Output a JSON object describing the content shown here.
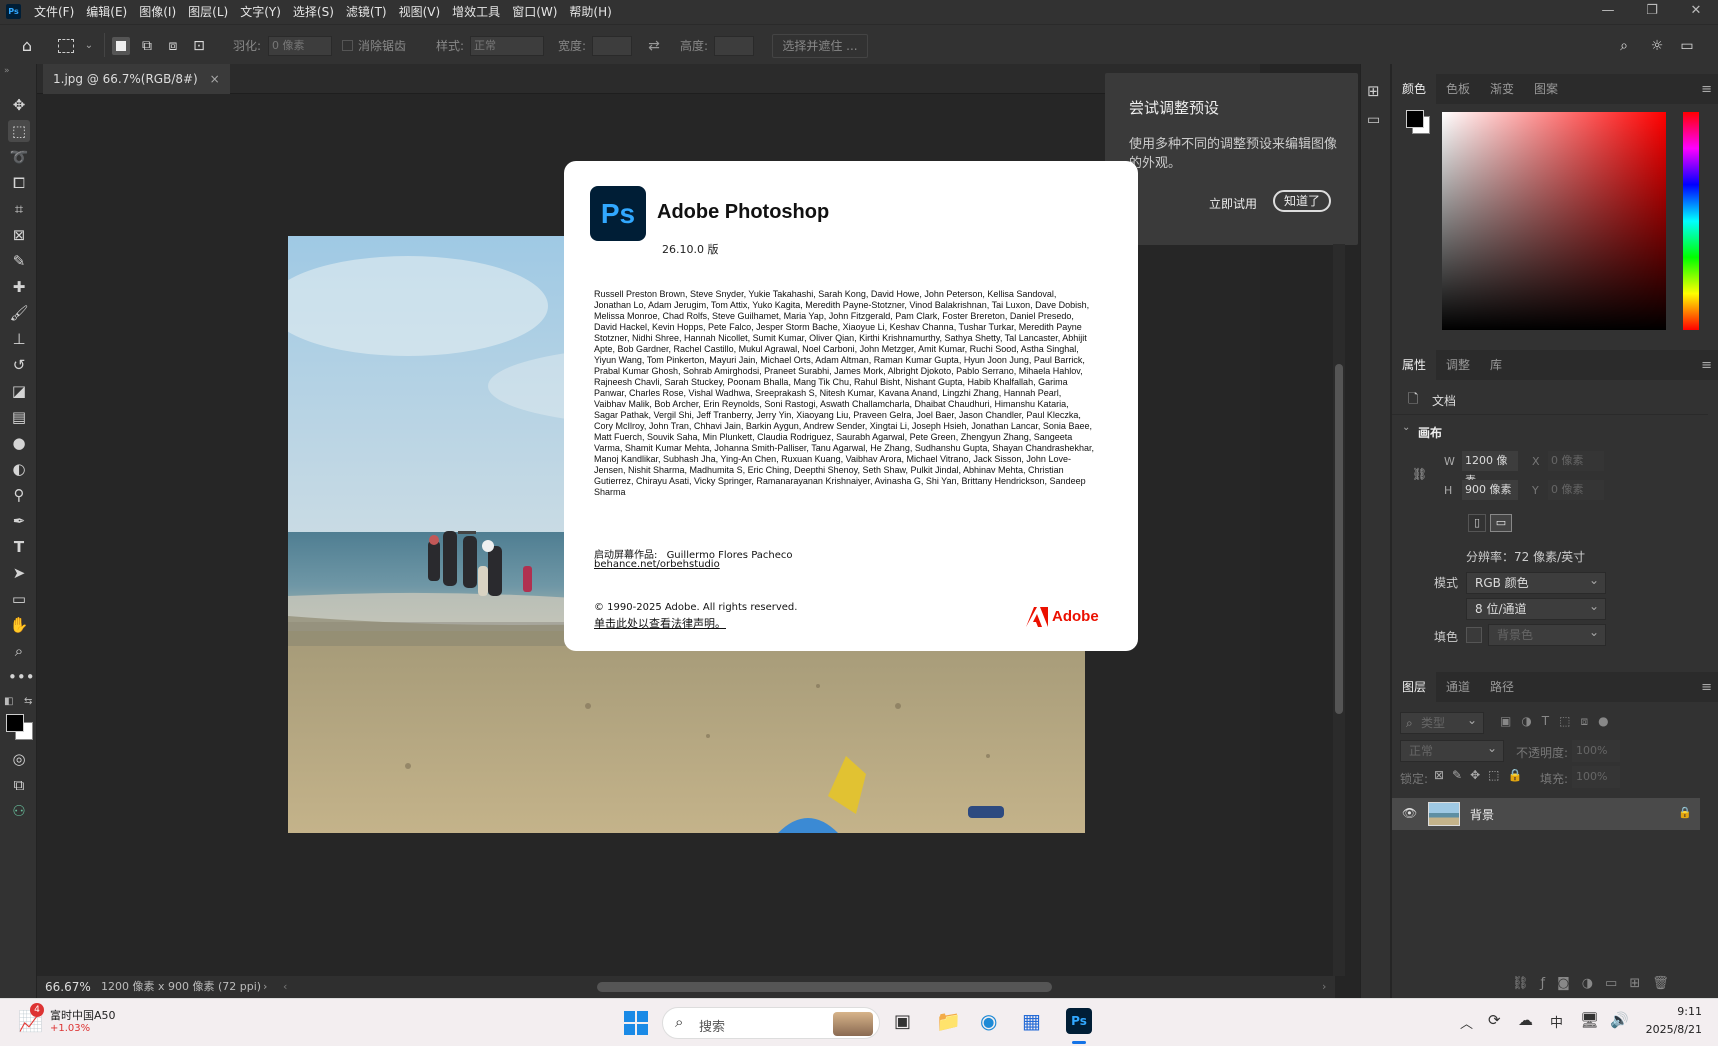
{
  "menubar": {
    "logo": "Ps",
    "items": [
      "文件(F)",
      "编辑(E)",
      "图像(I)",
      "图层(L)",
      "文字(Y)",
      "选择(S)",
      "滤镜(T)",
      "视图(V)",
      "增效工具",
      "窗口(W)",
      "帮助(H)"
    ]
  },
  "options": {
    "feather_label": "羽化:",
    "feather_value": "0 像素",
    "antialias_label": "消除锯齿",
    "style_label": "样式:",
    "style_value": "正常",
    "width_label": "宽度:",
    "height_label": "高度:",
    "select_mask": "选择并遮住 ..."
  },
  "document": {
    "tab_label": "1.jpg @ 66.7%(RGB/8#)",
    "zoom": "66.67%",
    "info": "1200 像素 x 900 像素 (72 ppi)"
  },
  "tip": {
    "title": "尝试调整预设",
    "body": "使用多种不同的调整预设来编辑图像的外观。",
    "try_label": "立即试用",
    "ok_label": "知道了"
  },
  "about": {
    "logo_text": "Ps",
    "app_name": "Adobe Photoshop",
    "version": "26.10.0 版",
    "credits": "Russell Preston Brown, Steve Snyder, Yukie Takahashi, Sarah Kong, David Howe, John Peterson, Kellisa Sandoval, Jonathan Lo, Adam Jerugim, Tom Attix, Yuko Kagita, Meredith Payne-Stotzner, Vinod Balakrishnan, Tai Luxon, Dave Dobish, Melissa Monroe, Chad Rolfs, Steve Guilhamet, Maria Yap, John Fitzgerald, Pam Clark, Foster Brereton, Daniel Presedo, David Hackel, Kevin Hopps, Pete Falco, Jesper Storm Bache, Xiaoyue Li, Keshav Channa, Tushar Turkar, Meredith Payne Stotzner, Nidhi Shree, Hannah Nicollet, Sumit Kumar, Oliver Qian, Kirthi Krishnamurthy, Sathya Shetty, Tal Lancaster, Abhijit Apte, Bob Gardner, Rachel Castillo, Mukul Agrawal, Noel Carboni, John Metzger, Amit Kumar, Ruchi Sood, Astha Singhal, Yiyun Wang, Tom Pinkerton, Mayuri Jain, Michael Orts, Adam Altman, Raman Kumar Gupta, Hyun Joon Jung, Paul Barrick, Prabal Kumar Ghosh, Sohrab Amirghodsi, Praneet Surabhi, James Mork, Albright Djokoto, Pablo Serrano, Mihaela Hahlov, Rajneesh Chavli, Sarah Stuckey, Poonam Bhalla, Mang Tik Chu, Rahul Bisht, Nishant Gupta, Habib Khalfallah, Garima Panwar, Charles Rose, Vishal Wadhwa, Sreeprakash S, Nitesh Kumar, Kavana Anand, Lingzhi Zhang, Hannah Pearl, Vaibhav Malik, Bob Archer, Erin Reynolds, Soni Rastogi, Aswath Challamcharla, Dhaibat Chaudhuri, Himanshu Kataria, Sagar Pathak, Vergil Shi, Jeff Tranberry, Jerry Yin, Xiaoyang Liu, Praveen Gelra, Joel Baer, Jason Chandler, Paul Kleczka, Cory McIlroy, John Tran, Chhavi Jain, Barkin Aygun, Andrew Sender, Xingtai Li, Joseph Hsieh, Jonathan Lancar, Sonia Baee, Matt Fuerch, Souvik Saha, Min Plunkett, Claudia Rodriguez, Saurabh Agarwal, Pete Green, Zhengyun Zhang, Sangeeta Varma, Shamit Kumar Mehta, Johanna Smith-Palliser, Tanu Agarwal, He Zhang, Sudhanshu Gupta, Shayan Chandrashekhar, Manoj Kandlikar, Subhash Jha, Ying-An Chen, Ruxuan Kuang, Vaibhav Arora, Michael Vitrano, Jack Sisson, John Love-Jensen, Nishit Sharma, Madhumita S, Eric Ching, Deepthi Shenoy, Seth Shaw, Pulkit Jindal, Abhinav Mehta, Christian Gutierrez, Chirayu Asati, Vicky Springer, Ramanarayanan Krishnaiyer, Avinasha G, Shi Yan, Brittany Hendrickson, Sandeep Sharma",
    "splash_label": "启动屏幕作品:",
    "splash_author": "Guillermo Flores Pacheco",
    "splash_link": "behance.net/orbehstudio",
    "copyright": "© 1990-2025 Adobe. All rights reserved.",
    "legal_link": "单击此处以查看法律声明。",
    "brand": "Adobe"
  },
  "panels": {
    "color_tabs": [
      "颜色",
      "色板",
      "渐变",
      "图案"
    ],
    "prop_tabs": [
      "属性",
      "调整",
      "库"
    ],
    "doc_label": "文档",
    "canvas_label": "画布",
    "w_label": "W",
    "w_value": "1200 像素",
    "h_label": "H",
    "h_value": "900 像素",
    "x_label": "X",
    "x_value": "0 像素",
    "y_label": "Y",
    "y_value": "0 像素",
    "resolution": "分辨率：72 像素/英寸",
    "mode_label": "模式",
    "mode_value": "RGB 颜色",
    "depth_value": "8 位/通道",
    "fill_label": "填色",
    "fill_value": "背景色",
    "layer_tabs": [
      "图层",
      "通道",
      "路径"
    ],
    "kind_value": "类型",
    "blend_value": "正常",
    "opacity_label": "不透明度:",
    "opacity_value": "100%",
    "lock_label": "锁定:",
    "fill2_label": "填充:",
    "fill2_value": "100%",
    "layer_name": "背景"
  },
  "taskbar": {
    "stock_name": "富时中国A50",
    "stock_change": "+1.03%",
    "stock_badge": "4",
    "search_label": "搜索",
    "ime": "中",
    "time": "9:11",
    "date": "2025/8/21"
  },
  "colors": {
    "ps_blue": "#31a8ff",
    "ps_dark": "#001e36",
    "adobe_red": "#eb1000",
    "accent": "#1473e6"
  }
}
